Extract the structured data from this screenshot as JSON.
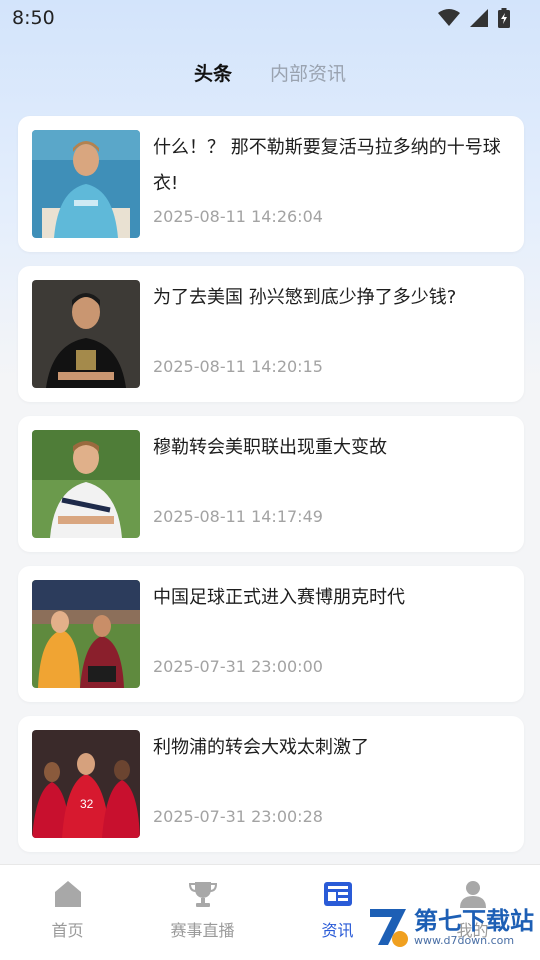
{
  "status": {
    "time": "8:50"
  },
  "tabs": [
    {
      "label": "头条",
      "active": true
    },
    {
      "label": "内部资讯",
      "active": false
    }
  ],
  "articles": [
    {
      "title": "什么！？ 那不勒斯要复活马拉多纳的十号球衣!",
      "time": "2025-08-11 14:26:04"
    },
    {
      "title": "为了去美国 孙兴慜到底少挣了多少钱?",
      "time": "2025-08-11 14:20:15"
    },
    {
      "title": "穆勒转会美职联出现重大变故",
      "time": "2025-08-11 14:17:49"
    },
    {
      "title": "中国足球正式进入赛博朋克时代",
      "time": "2025-07-31 23:00:00"
    },
    {
      "title": "利物浦的转会大戏太刺激了",
      "time": "2025-07-31 23:00:28"
    }
  ],
  "nav": [
    {
      "label": "首页",
      "icon": "home-icon"
    },
    {
      "label": "赛事直播",
      "icon": "trophy-icon"
    },
    {
      "label": "资讯",
      "icon": "news-icon",
      "active": true
    },
    {
      "label": "我的",
      "icon": "person-icon"
    }
  ],
  "watermark": {
    "text": "第七下载站",
    "url": "www.d7down.com"
  },
  "colors": {
    "accent": "#2a5bd7",
    "background": "#f4f5f7"
  }
}
